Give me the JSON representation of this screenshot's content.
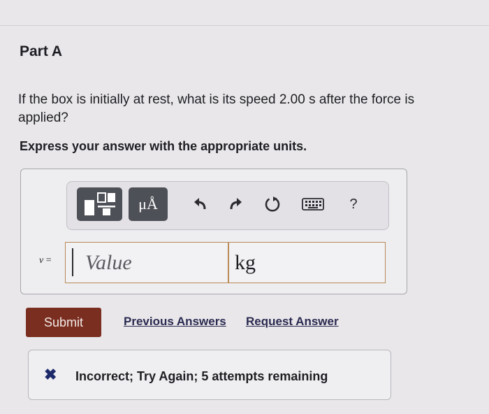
{
  "part": {
    "title": "Part A"
  },
  "question": {
    "text": "If the box is initially at rest, what is its speed 2.00 s after the force is applied?",
    "instruction": "Express your answer with the appropriate units."
  },
  "toolbar": {
    "templates_icon": "templates-icon",
    "units_label": "μÅ",
    "undo_icon": "undo-icon",
    "redo_icon": "redo-icon",
    "reset_icon": "reset-icon",
    "keyboard_icon": "keyboard-icon",
    "help_label": "?"
  },
  "answer": {
    "variable": "v",
    "equals": "=",
    "value_placeholder": "Value",
    "units_value": "kg"
  },
  "actions": {
    "submit_label": "Submit",
    "previous_answers_label": "Previous Answers",
    "request_answer_label": "Request Answer"
  },
  "feedback": {
    "icon": "x-icon",
    "message": "Incorrect; Try Again; 5 attempts remaining"
  },
  "colors": {
    "submit": "#7a2e20",
    "toolbar_button": "#4e5057",
    "field_border": "#b88a56",
    "feedback_icon": "#1c2a6a"
  }
}
